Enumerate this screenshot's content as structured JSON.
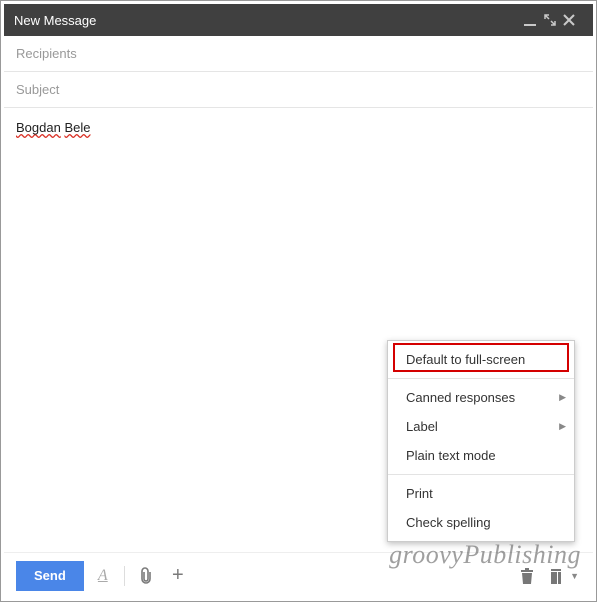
{
  "header": {
    "title": "New Message"
  },
  "fields": {
    "recipients_placeholder": "Recipients",
    "subject_placeholder": "Subject"
  },
  "body": {
    "word1": "Bogdan",
    "word2": "Bele"
  },
  "toolbar": {
    "send": "Send",
    "format_glyph": "A",
    "plus_glyph": "+"
  },
  "menu": {
    "default_fullscreen": "Default to full-screen",
    "canned": "Canned responses",
    "label": "Label",
    "plain_text": "Plain text mode",
    "print": "Print",
    "check_spelling": "Check spelling"
  },
  "watermark": "groovyPublishing"
}
